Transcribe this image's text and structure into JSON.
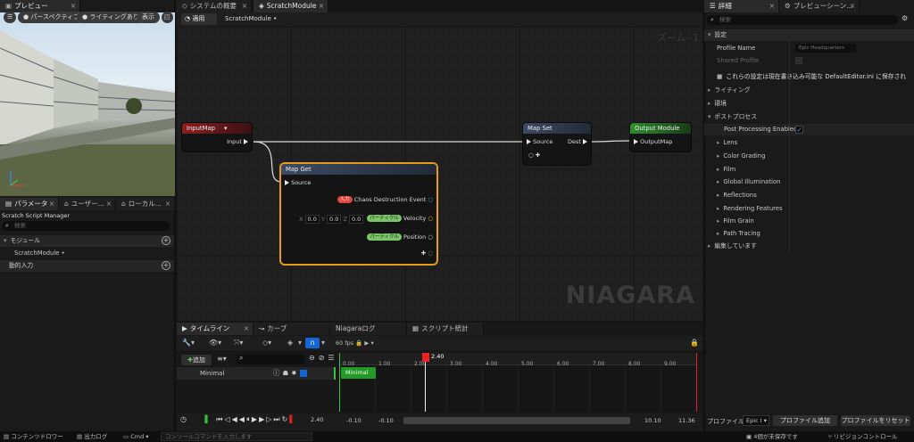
{
  "left_panel": {
    "preview_tab": "プレビュー",
    "preview_pills": [
      "パースペクティブ",
      "ライティングあり",
      "表示"
    ],
    "tabs": [
      "パラメータ",
      "ユーザー...",
      "ローカル..."
    ],
    "manager_title": "Scratch Script Manager",
    "search_placeholder": "検索",
    "module_section": "モジュール",
    "module_item": "ScratchModule •",
    "dynamic_input_section": "動的入力"
  },
  "center": {
    "tabs": [
      "システムの概要",
      "ScratchModule"
    ],
    "apply_button": "適用",
    "breadcrumb": "ScratchModule •",
    "zoom_label": "ズーム -1",
    "watermark": "NIAGARA",
    "nodes": {
      "input_map": {
        "title": "InputMap",
        "pin": "Input"
      },
      "map_set": {
        "title": "Map Set",
        "source": "Source",
        "dest": "Dest"
      },
      "output_module": {
        "title": "Output Module",
        "pin": "OutputMap"
      },
      "map_get": {
        "title": "Map Get",
        "source": "Source",
        "rows": [
          {
            "badge": "入力",
            "badge_color": "#e0453a",
            "label": "Chaos Destruction Event",
            "pin_color": "#3fa7d8"
          },
          {
            "badge": "パーティクル",
            "badge_color": "#7bc46a",
            "label": "Velocity",
            "pin_color": "#f0c020"
          },
          {
            "badge": "パーティクル",
            "badge_color": "#7bc46a",
            "label": "Position",
            "pin_color": "#dddddd"
          }
        ],
        "vector_fields": [
          {
            "axis": "X",
            "value": "0.0"
          },
          {
            "axis": "Y",
            "value": "0.0"
          },
          {
            "axis": "Z",
            "value": "0.0"
          }
        ]
      }
    }
  },
  "timeline": {
    "tabs": [
      "タイムライン",
      "カーブ",
      "Niagaraログ",
      "スクリプト統計"
    ],
    "fps": "60 fps",
    "add_button": "追加",
    "track_name": "Minimal",
    "clip_label": "Minimal",
    "ticks": [
      "0.00",
      "1.00",
      "2.00",
      "3.00",
      "4.00",
      "5.00",
      "6.00",
      "7.00",
      "8.00",
      "9.00"
    ],
    "playhead": "2.40",
    "current_time": "2.40",
    "range_start_a": "-0.10",
    "range_start_b": "-0.10",
    "range_end_a": "10.10",
    "range_end_b": "11.36"
  },
  "right_panel": {
    "tabs": [
      "詳細",
      "プレビューシーン..."
    ],
    "search_placeholder": "検索",
    "settings_section": "設定",
    "profile_name_label": "Profile Name",
    "profile_name_value": "Epic Headquarters",
    "shared_profile_label": "Shared Profile",
    "info_text": "これらの設定は現在書き込み可能な DefaultEditor.ini に保存され",
    "categories": [
      "ライティング",
      "環境",
      "ポストプロセス"
    ],
    "post_process_enabled_label": "Post Processing Enabled",
    "post_items": [
      "Lens",
      "Color Grading",
      "Film",
      "Global Illumination",
      "Reflections",
      "Rendering Features",
      "Film Grain",
      "Path Tracing"
    ],
    "editing_label": "編集しています",
    "profile_label": "プロファイル",
    "profile_select": "Epic I",
    "add_profile_button": "プロファイル追加",
    "reset_profile_button": "プロファイルをリセット"
  },
  "status_bar": {
    "content_drawer": "コンテンツドロワー",
    "output_log": "出力ログ",
    "cmd": "Cmd",
    "console_placeholder": "コンソールコマンドを入力します",
    "unsaved": "4個が未保存です",
    "revision": "リビジョンコントロール"
  }
}
